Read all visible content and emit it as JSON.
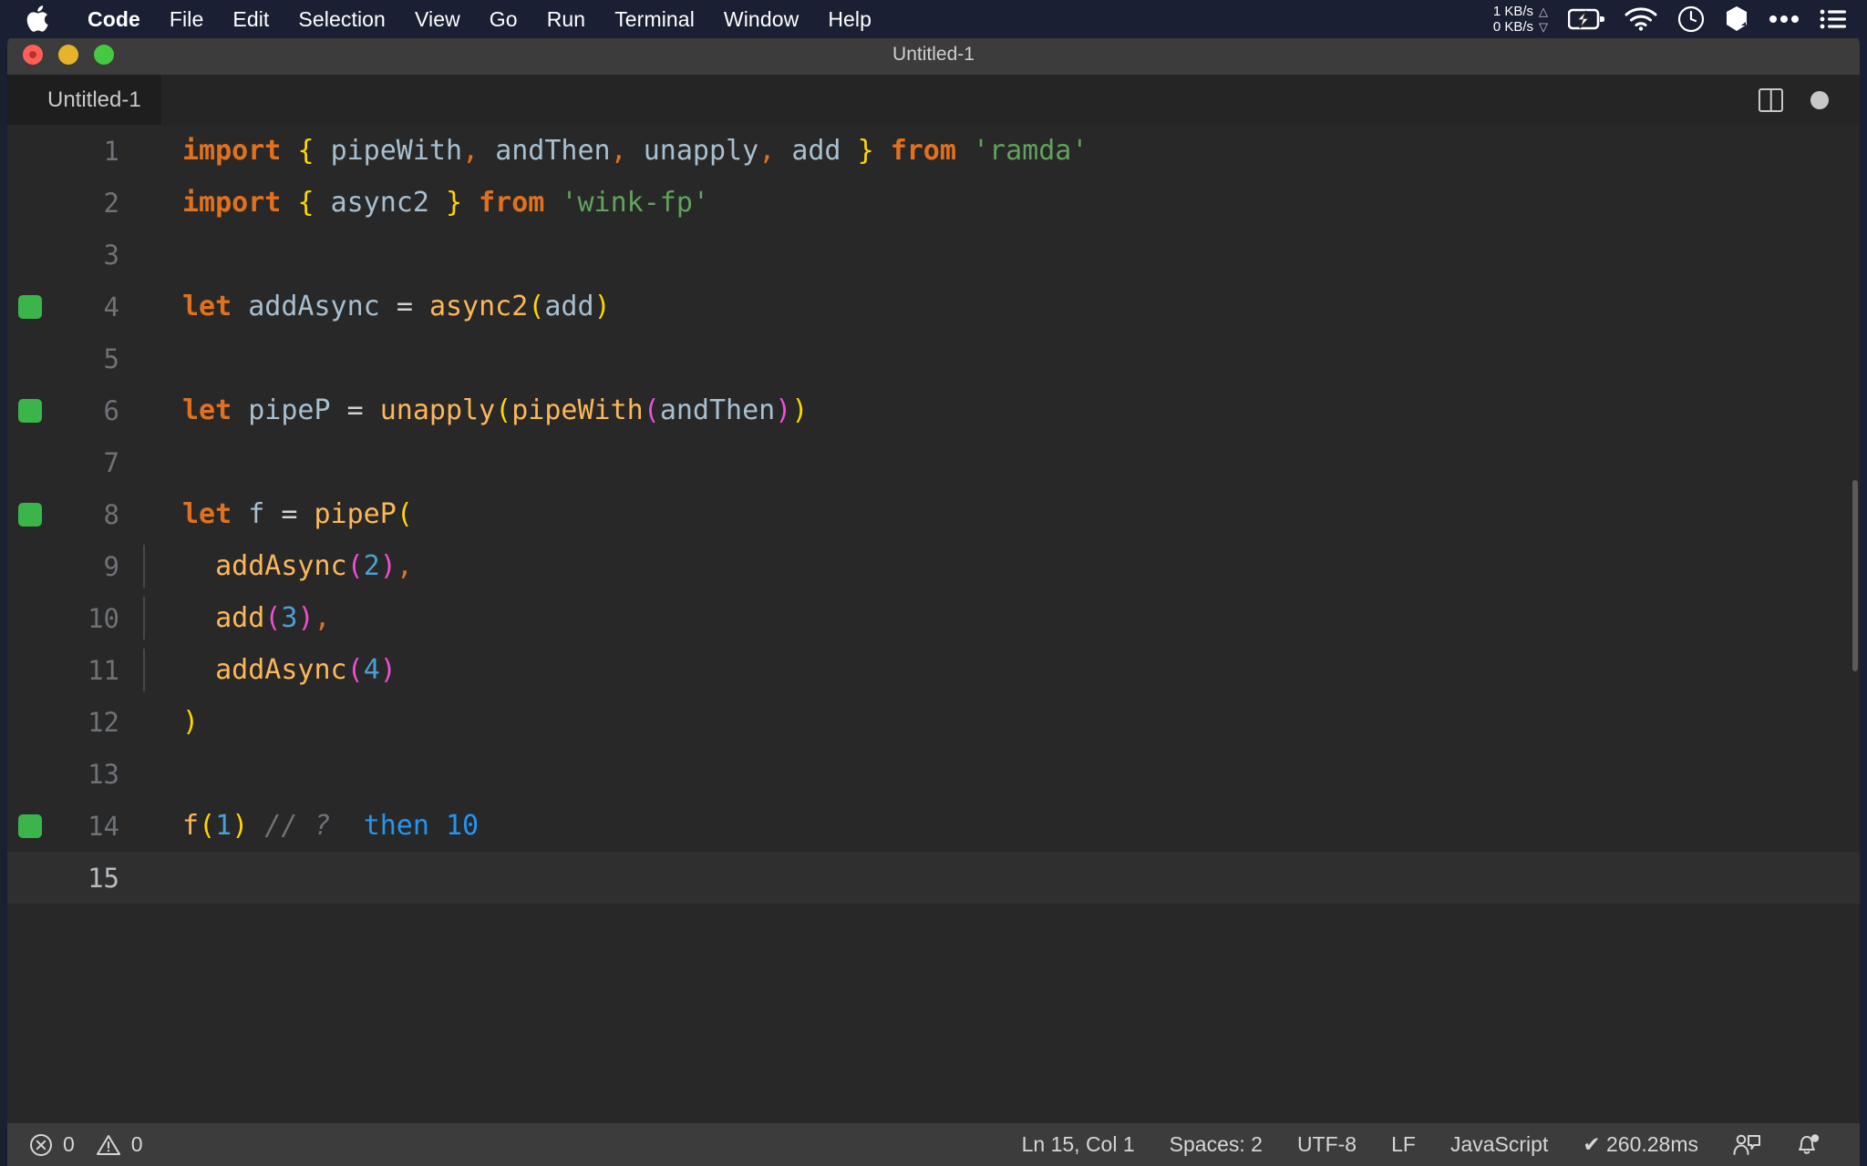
{
  "menubar": {
    "apple_icon": "apple-logo-icon",
    "items": [
      {
        "label": "Code",
        "bold": true
      },
      {
        "label": "File",
        "bold": false
      },
      {
        "label": "Edit",
        "bold": false
      },
      {
        "label": "Selection",
        "bold": false
      },
      {
        "label": "View",
        "bold": false
      },
      {
        "label": "Go",
        "bold": false
      },
      {
        "label": "Run",
        "bold": false
      },
      {
        "label": "Terminal",
        "bold": false
      },
      {
        "label": "Window",
        "bold": false
      },
      {
        "label": "Help",
        "bold": false
      }
    ],
    "status": {
      "net_up": "1 KB/s",
      "net_down": "0 KB/s",
      "up_arrow": "△",
      "down_arrow": "▽",
      "icons": [
        "battery-charging-icon",
        "wifi-icon",
        "clock-icon",
        "bartender-icon",
        "ellipsis-icon",
        "control-center-icon"
      ]
    }
  },
  "window": {
    "title": "Untitled-1",
    "traffic_lights": [
      "close-button",
      "minimize-button",
      "maximize-button"
    ]
  },
  "tabbar": {
    "tabs": [
      {
        "label": "Untitled-1",
        "active": true,
        "dirty": true
      }
    ],
    "actions": [
      "split-editor-icon",
      "unsaved-indicator"
    ]
  },
  "editor": {
    "language": "JavaScript",
    "lines": [
      {
        "n": "1",
        "marker": false,
        "active": false,
        "indent_guide": false,
        "tokens": [
          {
            "t": "import",
            "c": "kw"
          },
          {
            "t": " ",
            "c": "op"
          },
          {
            "t": "{",
            "c": "br1"
          },
          {
            "t": " ",
            "c": "op"
          },
          {
            "t": "pipeWith",
            "c": "id"
          },
          {
            "t": ",",
            "c": "punc-o"
          },
          {
            "t": " ",
            "c": "op"
          },
          {
            "t": "andThen",
            "c": "id"
          },
          {
            "t": ",",
            "c": "punc-o"
          },
          {
            "t": " ",
            "c": "op"
          },
          {
            "t": "unapply",
            "c": "id"
          },
          {
            "t": ",",
            "c": "punc-o"
          },
          {
            "t": " ",
            "c": "op"
          },
          {
            "t": "add",
            "c": "id"
          },
          {
            "t": " ",
            "c": "op"
          },
          {
            "t": "}",
            "c": "br1"
          },
          {
            "t": " ",
            "c": "op"
          },
          {
            "t": "from",
            "c": "kw"
          },
          {
            "t": " ",
            "c": "op"
          },
          {
            "t": "'ramda'",
            "c": "str"
          }
        ]
      },
      {
        "n": "2",
        "marker": false,
        "active": false,
        "indent_guide": false,
        "tokens": [
          {
            "t": "import",
            "c": "kw"
          },
          {
            "t": " ",
            "c": "op"
          },
          {
            "t": "{",
            "c": "br1"
          },
          {
            "t": " ",
            "c": "op"
          },
          {
            "t": "async2",
            "c": "id"
          },
          {
            "t": " ",
            "c": "op"
          },
          {
            "t": "}",
            "c": "br1"
          },
          {
            "t": " ",
            "c": "op"
          },
          {
            "t": "from",
            "c": "kw"
          },
          {
            "t": " ",
            "c": "op"
          },
          {
            "t": "'wink-fp'",
            "c": "str"
          }
        ]
      },
      {
        "n": "3",
        "marker": false,
        "active": false,
        "indent_guide": false,
        "tokens": []
      },
      {
        "n": "4",
        "marker": true,
        "active": false,
        "indent_guide": false,
        "tokens": [
          {
            "t": "let",
            "c": "kw"
          },
          {
            "t": " ",
            "c": "op"
          },
          {
            "t": "addAsync",
            "c": "id"
          },
          {
            "t": " ",
            "c": "op"
          },
          {
            "t": "=",
            "c": "op"
          },
          {
            "t": " ",
            "c": "op"
          },
          {
            "t": "async2",
            "c": "fn"
          },
          {
            "t": "(",
            "c": "br1"
          },
          {
            "t": "add",
            "c": "id"
          },
          {
            "t": ")",
            "c": "br1"
          }
        ]
      },
      {
        "n": "5",
        "marker": false,
        "active": false,
        "indent_guide": false,
        "tokens": []
      },
      {
        "n": "6",
        "marker": true,
        "active": false,
        "indent_guide": false,
        "tokens": [
          {
            "t": "let",
            "c": "kw"
          },
          {
            "t": " ",
            "c": "op"
          },
          {
            "t": "pipeP",
            "c": "id"
          },
          {
            "t": " ",
            "c": "op"
          },
          {
            "t": "=",
            "c": "op"
          },
          {
            "t": " ",
            "c": "op"
          },
          {
            "t": "unapply",
            "c": "fn"
          },
          {
            "t": "(",
            "c": "br1"
          },
          {
            "t": "pipeWith",
            "c": "fn"
          },
          {
            "t": "(",
            "c": "br2"
          },
          {
            "t": "andThen",
            "c": "id"
          },
          {
            "t": ")",
            "c": "br2"
          },
          {
            "t": ")",
            "c": "br1"
          }
        ]
      },
      {
        "n": "7",
        "marker": false,
        "active": false,
        "indent_guide": false,
        "tokens": []
      },
      {
        "n": "8",
        "marker": true,
        "active": false,
        "indent_guide": false,
        "tokens": [
          {
            "t": "let",
            "c": "kw"
          },
          {
            "t": " ",
            "c": "op"
          },
          {
            "t": "f",
            "c": "id"
          },
          {
            "t": " ",
            "c": "op"
          },
          {
            "t": "=",
            "c": "op"
          },
          {
            "t": " ",
            "c": "op"
          },
          {
            "t": "pipeP",
            "c": "fn"
          },
          {
            "t": "(",
            "c": "br1"
          }
        ]
      },
      {
        "n": "9",
        "marker": false,
        "active": false,
        "indent_guide": true,
        "tokens": [
          {
            "t": "  ",
            "c": "op"
          },
          {
            "t": "addAsync",
            "c": "fn"
          },
          {
            "t": "(",
            "c": "br2"
          },
          {
            "t": "2",
            "c": "num"
          },
          {
            "t": ")",
            "c": "br2"
          },
          {
            "t": ",",
            "c": "punc-o"
          }
        ]
      },
      {
        "n": "10",
        "marker": false,
        "active": false,
        "indent_guide": true,
        "tokens": [
          {
            "t": "  ",
            "c": "op"
          },
          {
            "t": "add",
            "c": "fn"
          },
          {
            "t": "(",
            "c": "br2"
          },
          {
            "t": "3",
            "c": "num"
          },
          {
            "t": ")",
            "c": "br2"
          },
          {
            "t": ",",
            "c": "punc-o"
          }
        ]
      },
      {
        "n": "11",
        "marker": false,
        "active": false,
        "indent_guide": true,
        "tokens": [
          {
            "t": "  ",
            "c": "op"
          },
          {
            "t": "addAsync",
            "c": "fn"
          },
          {
            "t": "(",
            "c": "br2"
          },
          {
            "t": "4",
            "c": "num"
          },
          {
            "t": ")",
            "c": "br2"
          }
        ]
      },
      {
        "n": "12",
        "marker": false,
        "active": false,
        "indent_guide": false,
        "tokens": [
          {
            "t": ")",
            "c": "br1"
          }
        ]
      },
      {
        "n": "13",
        "marker": false,
        "active": false,
        "indent_guide": false,
        "tokens": []
      },
      {
        "n": "14",
        "marker": true,
        "active": false,
        "indent_guide": false,
        "tokens": [
          {
            "t": "f",
            "c": "fn"
          },
          {
            "t": "(",
            "c": "br1"
          },
          {
            "t": "1",
            "c": "num"
          },
          {
            "t": ")",
            "c": "br1"
          },
          {
            "t": " ",
            "c": "op"
          },
          {
            "t": "// ?",
            "c": "cmt"
          },
          {
            "t": "  ",
            "c": "op"
          },
          {
            "t": "then 10",
            "c": "quokka"
          }
        ]
      },
      {
        "n": "15",
        "marker": false,
        "active": true,
        "indent_guide": false,
        "tokens": []
      }
    ]
  },
  "statusbar": {
    "errors": "0",
    "warnings": "0",
    "error_icon": "error-circle-icon",
    "warning_icon": "warning-triangle-icon",
    "cursor_position": "Ln 15, Col 1",
    "indentation": "Spaces: 2",
    "encoding": "UTF-8",
    "eol": "LF",
    "language_mode": "JavaScript",
    "run_time": "✔ 260.28ms",
    "feedback_icon": "feedback-person-icon",
    "bell_icon": "notification-bell-icon"
  },
  "colors": {
    "menubar_bg": "#1b1f33",
    "titlebar_bg": "#3c3c3c",
    "editor_bg": "#282828",
    "statusbar_bg": "#3c3c3c",
    "keyword": "#e2711d",
    "function": "#fcb757",
    "identifier": "#a8bfd0",
    "string": "#60a35c",
    "number": "#4b9fd6",
    "comment": "#6e7277",
    "bracket_level1": "#ffd500",
    "bracket_level2": "#ef4ed6",
    "quokka_value": "#2196f3",
    "marker_green": "#3bb54a"
  }
}
